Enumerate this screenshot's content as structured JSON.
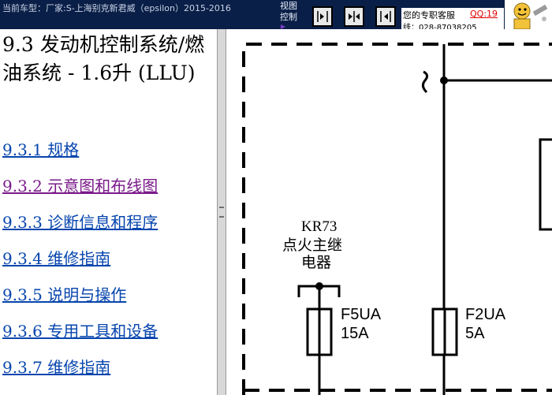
{
  "header": {
    "vehicle": "当前车型：厂家:S-上海别克新君威（epsilon）2015-2016",
    "view_control": "视图控制",
    "support_label": "您的专职客服",
    "qq": "QQ:19",
    "tel": "线：028-87038205"
  },
  "content": {
    "title": "9.3 发动机控制系统/燃油系统 - 1.6升 (LLU)",
    "toc": [
      {
        "label": "9.3.1 规格",
        "visited": false
      },
      {
        "label": "9.3.2 示意图和布线图",
        "visited": true
      },
      {
        "label": "9.3.3 诊断信息和程序",
        "visited": false
      },
      {
        "label": "9.3.4 维修指南",
        "visited": false
      },
      {
        "label": "9.3.5 说明与操作",
        "visited": false
      },
      {
        "label": "9.3.6 专用工具和设备",
        "visited": false
      },
      {
        "label": "9.3.7 维修指南",
        "visited": false
      }
    ]
  },
  "diagram": {
    "relay_id": "KR73",
    "relay_name_line1": "点火主继",
    "relay_name_line2": "电器",
    "fuse1_id": "F5UA",
    "fuse1_rating": "15A",
    "fuse2_id": "F2UA",
    "fuse2_rating": "5A"
  }
}
